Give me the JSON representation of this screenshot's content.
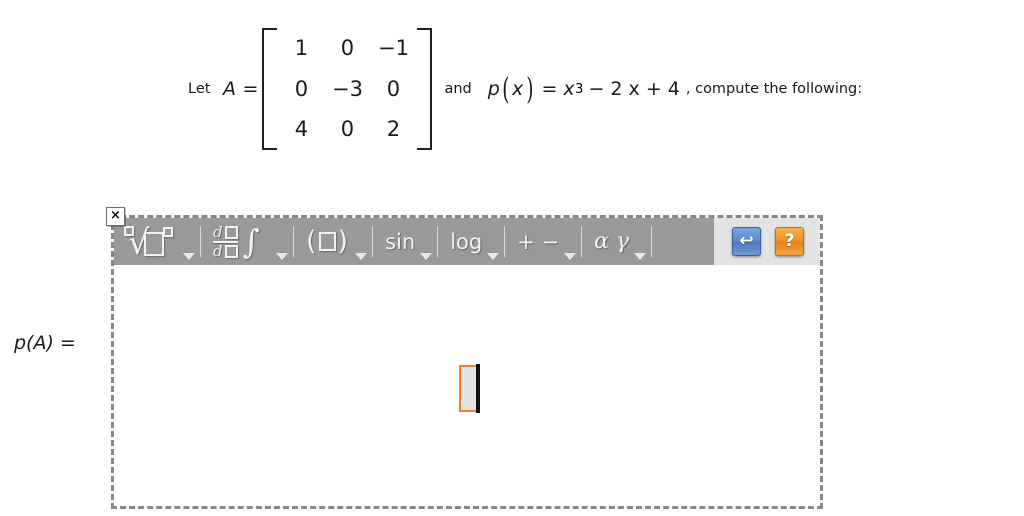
{
  "problem": {
    "intro": "Let ",
    "matrix_var": "A",
    "equals": "=",
    "matrix": [
      [
        "1",
        "0",
        "−1"
      ],
      [
        "0",
        "−3",
        "0"
      ],
      [
        "4",
        "0",
        "2"
      ]
    ],
    "conjunction": "and",
    "poly_name": "p",
    "paren_open": "(",
    "poly_arg": "x",
    "paren_close": ")",
    "poly_equals": "=",
    "poly_base": "x",
    "poly_exponent": "3",
    "poly_rest": "− 2 x + 4",
    "instruction": ", compute the following:"
  },
  "answer": {
    "label": "p(A) ="
  },
  "editor": {
    "close_label": "×",
    "toolbar": {
      "groups": [
        {
          "name": "radical",
          "label": "",
          "caret": true
        },
        {
          "name": "calculus",
          "label": "",
          "caret": true
        },
        {
          "name": "parentheses",
          "label": "",
          "caret": true
        },
        {
          "name": "trig",
          "label": "sin",
          "caret": true
        },
        {
          "name": "logarithm",
          "label": "log",
          "caret": true
        },
        {
          "name": "operators",
          "label": "+ −",
          "caret": true
        },
        {
          "name": "greek",
          "label": "α γ",
          "caret": true
        }
      ],
      "derivative": {
        "numerator_d": "d",
        "denominator_d": "d",
        "integral": "∫"
      },
      "parentheses": {
        "open": "(",
        "close": ")"
      },
      "actions": [
        {
          "name": "undo",
          "glyph": "↩",
          "color": "#5b86c9"
        },
        {
          "name": "help",
          "glyph": "?",
          "color": "#ed8f24"
        }
      ]
    },
    "canvas": {
      "placeholder_value": "",
      "cursor_color": "#f07d28"
    }
  }
}
